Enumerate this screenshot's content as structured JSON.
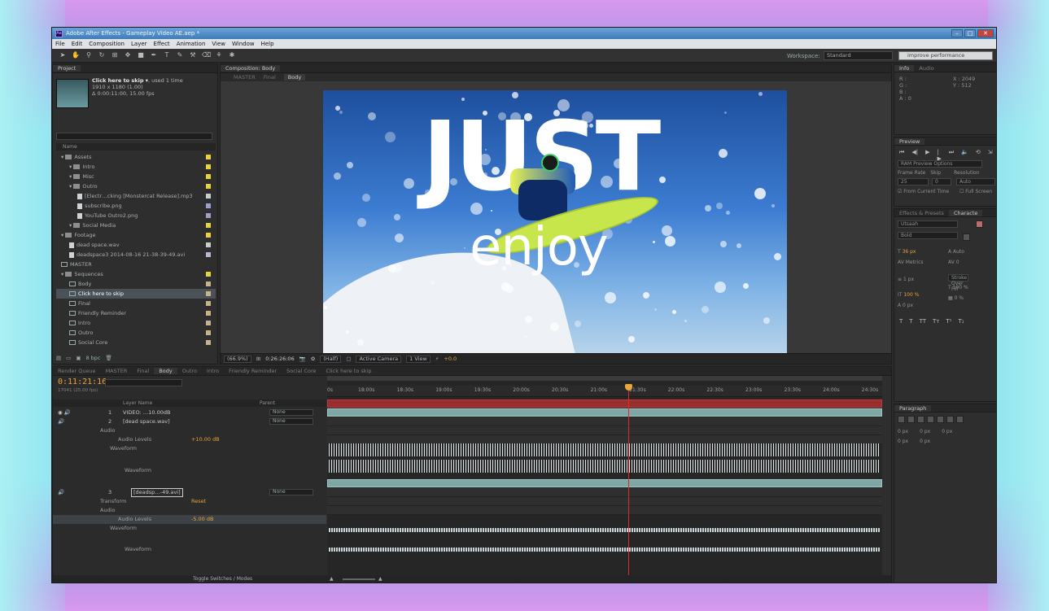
{
  "window": {
    "title": "Adobe After Effects - Gameplay Video AE.aep *",
    "app_icon": "Ae",
    "controls": [
      "–",
      "□",
      "✕"
    ]
  },
  "menu": [
    "File",
    "Edit",
    "Composition",
    "Layer",
    "Effect",
    "Animation",
    "View",
    "Window",
    "Help"
  ],
  "toolbar": {
    "workspace_label": "Workspace:",
    "workspace_value": "Standard",
    "search_placeholder": "improve performance"
  },
  "project": {
    "tab": "Project",
    "selected_name": "Click here to skip ▾",
    "selected_used": ", used 1 time",
    "selected_dims": "1910 x 1180 (1.00)",
    "selected_duration": "Δ 0:00:11:00, 15.00 fps",
    "column_name": "Name",
    "items": [
      {
        "label": "Assets",
        "kind": "folder",
        "indent": 0,
        "color": "#e6d33a"
      },
      {
        "label": "Intro",
        "kind": "folder",
        "indent": 1,
        "color": "#e6d33a"
      },
      {
        "label": "Misc",
        "kind": "folder",
        "indent": 1,
        "color": "#e6d33a"
      },
      {
        "label": "Outro",
        "kind": "folder",
        "indent": 1,
        "color": "#e6d33a"
      },
      {
        "label": "[Electr…cking [Monstercat Release].mp3",
        "kind": "file",
        "indent": 2,
        "color": "#c9cdd0"
      },
      {
        "label": "subscribe.png",
        "kind": "file",
        "indent": 2,
        "color": "#9aa0c8"
      },
      {
        "label": "YouTube Outro2.png",
        "kind": "file",
        "indent": 2,
        "color": "#9aa0c8"
      },
      {
        "label": "Social Media",
        "kind": "folder",
        "indent": 1,
        "color": "#e6d33a"
      },
      {
        "label": "Footage",
        "kind": "folder",
        "indent": 0,
        "color": "#e6d33a"
      },
      {
        "label": "dead space.wav",
        "kind": "file",
        "indent": 1,
        "color": "#c9cdd0"
      },
      {
        "label": "deadspace3 2014-08-16 21-38-39-49.avi",
        "kind": "file",
        "indent": 1,
        "color": "#b8b8d6"
      },
      {
        "label": "MASTER",
        "kind": "comp",
        "indent": 0,
        "color": ""
      },
      {
        "label": "Sequences",
        "kind": "folder",
        "indent": 0,
        "color": "#e6d33a"
      },
      {
        "label": "Body",
        "kind": "comp",
        "indent": 1,
        "color": "#c8b28a"
      },
      {
        "label": "Click here to skip",
        "kind": "comp",
        "indent": 1,
        "color": "#c8b28a",
        "selected": true
      },
      {
        "label": "Final",
        "kind": "comp",
        "indent": 1,
        "color": "#c8b28a"
      },
      {
        "label": "Friendly Reminder",
        "kind": "comp",
        "indent": 1,
        "color": "#c8b28a"
      },
      {
        "label": "Intro",
        "kind": "comp",
        "indent": 1,
        "color": "#c8b28a"
      },
      {
        "label": "Outro",
        "kind": "comp",
        "indent": 1,
        "color": "#c8b28a"
      },
      {
        "label": "Social Core",
        "kind": "comp",
        "indent": 1,
        "color": "#c8b28a"
      }
    ],
    "bpc": "8 bpc"
  },
  "composition": {
    "tab": "Composition: Body",
    "sub_tabs": [
      "MASTER",
      "Final",
      "Body"
    ],
    "frame_text_big": "JUST",
    "frame_text_small": "enjoy",
    "zoom": "(66.9%)",
    "timecode": "0:26:26:06",
    "resolution": "(Half)",
    "camera": "Active Camera",
    "views": "1 View",
    "exposure": "+0.0"
  },
  "info": {
    "tabs": [
      "Info",
      "Audio"
    ],
    "r": "R :",
    "g": "G :",
    "b": "B :",
    "a": "A : 0",
    "x": "X : 2049",
    "y": "Y : 512"
  },
  "preview": {
    "tab": "Preview",
    "buttons": [
      "⏮",
      "◀|",
      "▶",
      "|▶",
      "⏭",
      "🔈",
      "⟲",
      "⇲"
    ],
    "ram_options": "RAM Preview Options",
    "frame_rate_label": "Frame Rate",
    "skip_label": "Skip",
    "resolution_label": "Resolution",
    "frame_rate": "25",
    "skip": "0",
    "resolution": "Auto",
    "from_current": "From Current Time",
    "full_screen": "Full Screen"
  },
  "character": {
    "tabs": [
      "Effects & Presets",
      "Characte"
    ],
    "font": "Utsaah",
    "style": "Bold",
    "size": "36 px",
    "leading": "Auto",
    "tracking": "Metrics",
    "kerning": "0",
    "stroke_width": "1 px",
    "stroke_mode": "Stroke Over Fill",
    "vscale": "100 %",
    "hscale": "100 %",
    "baseline": "0 px",
    "tsume": "0 %",
    "styles": [
      "T",
      "T",
      "TT",
      "Tᴛ",
      "T¹",
      "T₁"
    ]
  },
  "paragraph": {
    "tab": "Paragraph",
    "indent_left": "0 px",
    "indent_right": "0 px",
    "indent_first": "0 px",
    "space_before": "0 px",
    "space_after": "0 px"
  },
  "timeline": {
    "tabs": [
      "Render Queue",
      "MASTER",
      "Final",
      "Body",
      "Outro",
      "Intro",
      "Friendly Reminder",
      "Social Core",
      "Click here to skip"
    ],
    "active_tab": "Body",
    "timecode": "0:11:21:16",
    "timecode_frames": "17041 (25.00 fps)",
    "col_layer_name": "Layer Name",
    "col_parent": "Parent",
    "ruler_labels": [
      "0s",
      "18:00s",
      "18:30s",
      "19:00s",
      "19:30s",
      "20:00s",
      "20:30s",
      "21:00s",
      "21:30s",
      "22:00s",
      "22:30s",
      "23:00s",
      "23:30s",
      "24:00s",
      "24:30s"
    ],
    "layers": [
      {
        "num": "1",
        "name": "VIDEO: …10.00dB",
        "parent": "None"
      },
      {
        "num": "2",
        "name": "[dead space.wav]",
        "parent": "None"
      },
      {
        "num": "3",
        "name": "[deadsp…-49.avi]",
        "parent": "None"
      }
    ],
    "props": {
      "audio": "Audio",
      "audio_levels": "Audio Levels",
      "waveform": "Waveform",
      "transform": "Transform",
      "reset": "Reset",
      "level_2": "+10.00 dB",
      "level_3": "-5.00 dB"
    },
    "toggle_label": "Toggle Switches / Modes"
  }
}
